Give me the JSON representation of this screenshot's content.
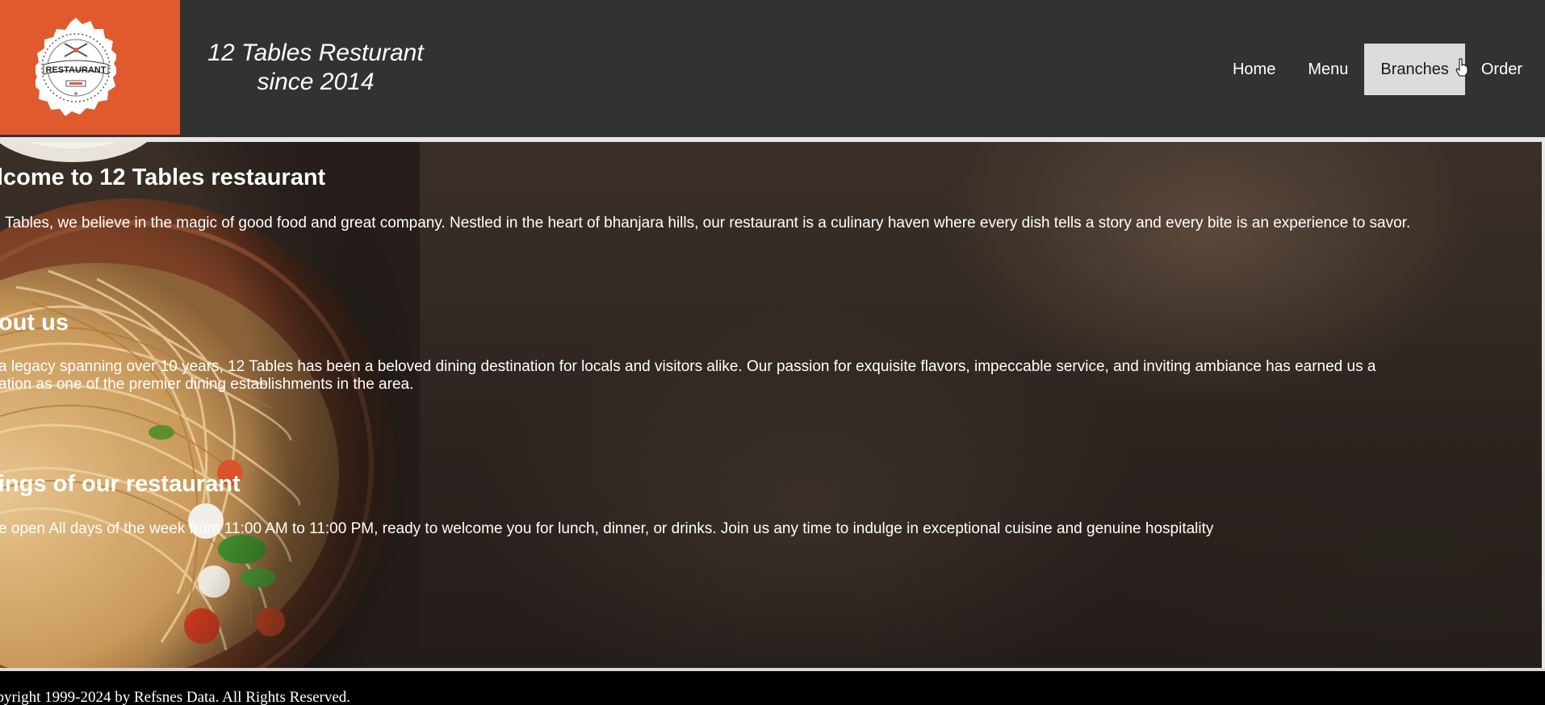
{
  "header": {
    "logo": {
      "badge_text": "RESTAURANT",
      "icon": "restaurant-badge-icon"
    },
    "brand_line1": "12 Tables Resturant",
    "brand_line2": "since 2014",
    "colors": {
      "header_bg": "#323232",
      "logo_bg": "#e05a2e",
      "active_nav_bg": "#dcdcdc"
    }
  },
  "nav": {
    "items": [
      {
        "label": "Home",
        "active": false
      },
      {
        "label": "Menu",
        "active": false
      },
      {
        "label": "Branches",
        "active": true
      },
      {
        "label": "Order",
        "active": false
      }
    ]
  },
  "hero": {
    "welcome_heading": "lcome to 12 Tables restaurant",
    "welcome_text": "Tables, we believe in the magic of good food and great company. Nestled in the heart of bhanjara hills, our restaurant is a culinary haven where every dish tells a story and every bite is an experience to savor.",
    "about_heading": "out us",
    "about_text_line1": "a legacy spanning over 10 years, 12 Tables has been a beloved dining destination for locals and visitors alike. Our passion for exquisite flavors, impeccable service, and inviting ambiance has earned us a",
    "about_text_line2": "ation as one of the premier dining establishments in the area.",
    "timings_heading": "ings of our restaurant",
    "timings_text": "e open All days of the week from 11:00 AM to 11:00 PM, ready to welcome you for lunch, dinner, or drinks. Join us any time to indulge in exceptional cuisine and genuine hospitality"
  },
  "footer": {
    "copyright": "opyright 1999-2024 by Refsnes Data. All Rights Reserved."
  }
}
